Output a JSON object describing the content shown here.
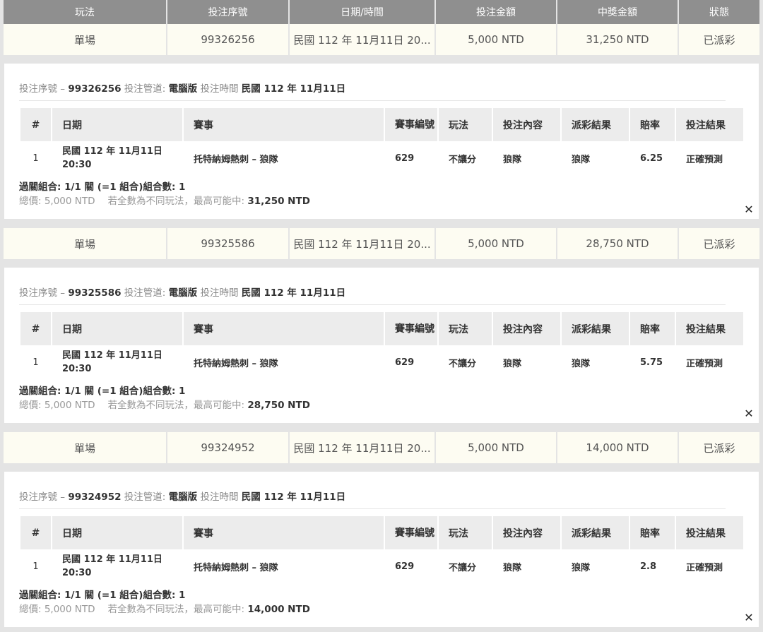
{
  "table_header": [
    "玩法",
    "投注序號",
    "日期/時間",
    "投注金額",
    "中獎金額",
    "狀態"
  ],
  "detail_table_header": {
    "num": "#",
    "date": "日期",
    "match": "賽事",
    "match_no": "賽事編號",
    "play": "玩法",
    "content": "投注內容",
    "result": "派彩結果",
    "odds": "賠率",
    "bet_result": "投注結果"
  },
  "bets": [
    {
      "summary": {
        "play": "單場",
        "serial": "99326256",
        "datetime": "民國 112 年 11月11日 20...",
        "amount": "5,000 NTD",
        "prize": "31,250 NTD",
        "status": "已派彩"
      },
      "detail": {
        "serial_label": "投注序號",
        "dash": "–",
        "serial": "99326256",
        "channel_label": "投注管道:",
        "channel": "電腦版",
        "time_label": "投注時間",
        "time": "民國 112 年 11月11日",
        "row": {
          "num": "1",
          "date_line1": "民國 112 年 11月11日",
          "date_line2": "20:30",
          "match": "托特納姆熱刺 – 狼隊",
          "match_no": "629",
          "play": "不讓分",
          "content": "狼隊",
          "result": "狼隊",
          "odds": "6.25",
          "bet_result": "正確預測"
        },
        "combo": "過關組合: 1/1 關 (=1 組合)組合數: 1",
        "total_label": "總價: 5,000 NTD",
        "max_label": "若全數為不同玩法，最高可能中:",
        "max_value": "31,250 NTD",
        "close": "✕"
      }
    },
    {
      "summary": {
        "play": "單場",
        "serial": "99325586",
        "datetime": "民國 112 年 11月11日 20...",
        "amount": "5,000 NTD",
        "prize": "28,750 NTD",
        "status": "已派彩"
      },
      "detail": {
        "serial_label": "投注序號",
        "dash": "–",
        "serial": "99325586",
        "channel_label": "投注管道:",
        "channel": "電腦版",
        "time_label": "投注時間",
        "time": "民國 112 年 11月11日",
        "row": {
          "num": "1",
          "date_line1": "民國 112 年 11月11日",
          "date_line2": "20:30",
          "match": "托特納姆熱刺 – 狼隊",
          "match_no": "629",
          "play": "不讓分",
          "content": "狼隊",
          "result": "狼隊",
          "odds": "5.75",
          "bet_result": "正確預測"
        },
        "combo": "過關組合: 1/1 關 (=1 組合)組合數: 1",
        "total_label": "總價: 5,000 NTD",
        "max_label": "若全數為不同玩法，最高可能中:",
        "max_value": "28,750 NTD",
        "close": "✕"
      }
    },
    {
      "summary": {
        "play": "單場",
        "serial": "99324952",
        "datetime": "民國 112 年 11月11日 20...",
        "amount": "5,000 NTD",
        "prize": "14,000 NTD",
        "status": "已派彩"
      },
      "detail": {
        "serial_label": "投注序號",
        "dash": "–",
        "serial": "99324952",
        "channel_label": "投注管道:",
        "channel": "電腦版",
        "time_label": "投注時間",
        "time": "民國 112 年 11月11日",
        "row": {
          "num": "1",
          "date_line1": "民國 112 年 11月11日",
          "date_line2": "20:30",
          "match": "托特納姆熱刺 – 狼隊",
          "match_no": "629",
          "play": "不讓分",
          "content": "狼隊",
          "result": "狼隊",
          "odds": "2.8",
          "bet_result": "正確預測"
        },
        "combo": "過關組合: 1/1 關 (=1 組合)組合數: 1",
        "total_label": "總價: 5,000 NTD",
        "max_label": "若全數為不同玩法，最高可能中:",
        "max_value": "14,000 NTD",
        "close": "✕"
      }
    }
  ]
}
